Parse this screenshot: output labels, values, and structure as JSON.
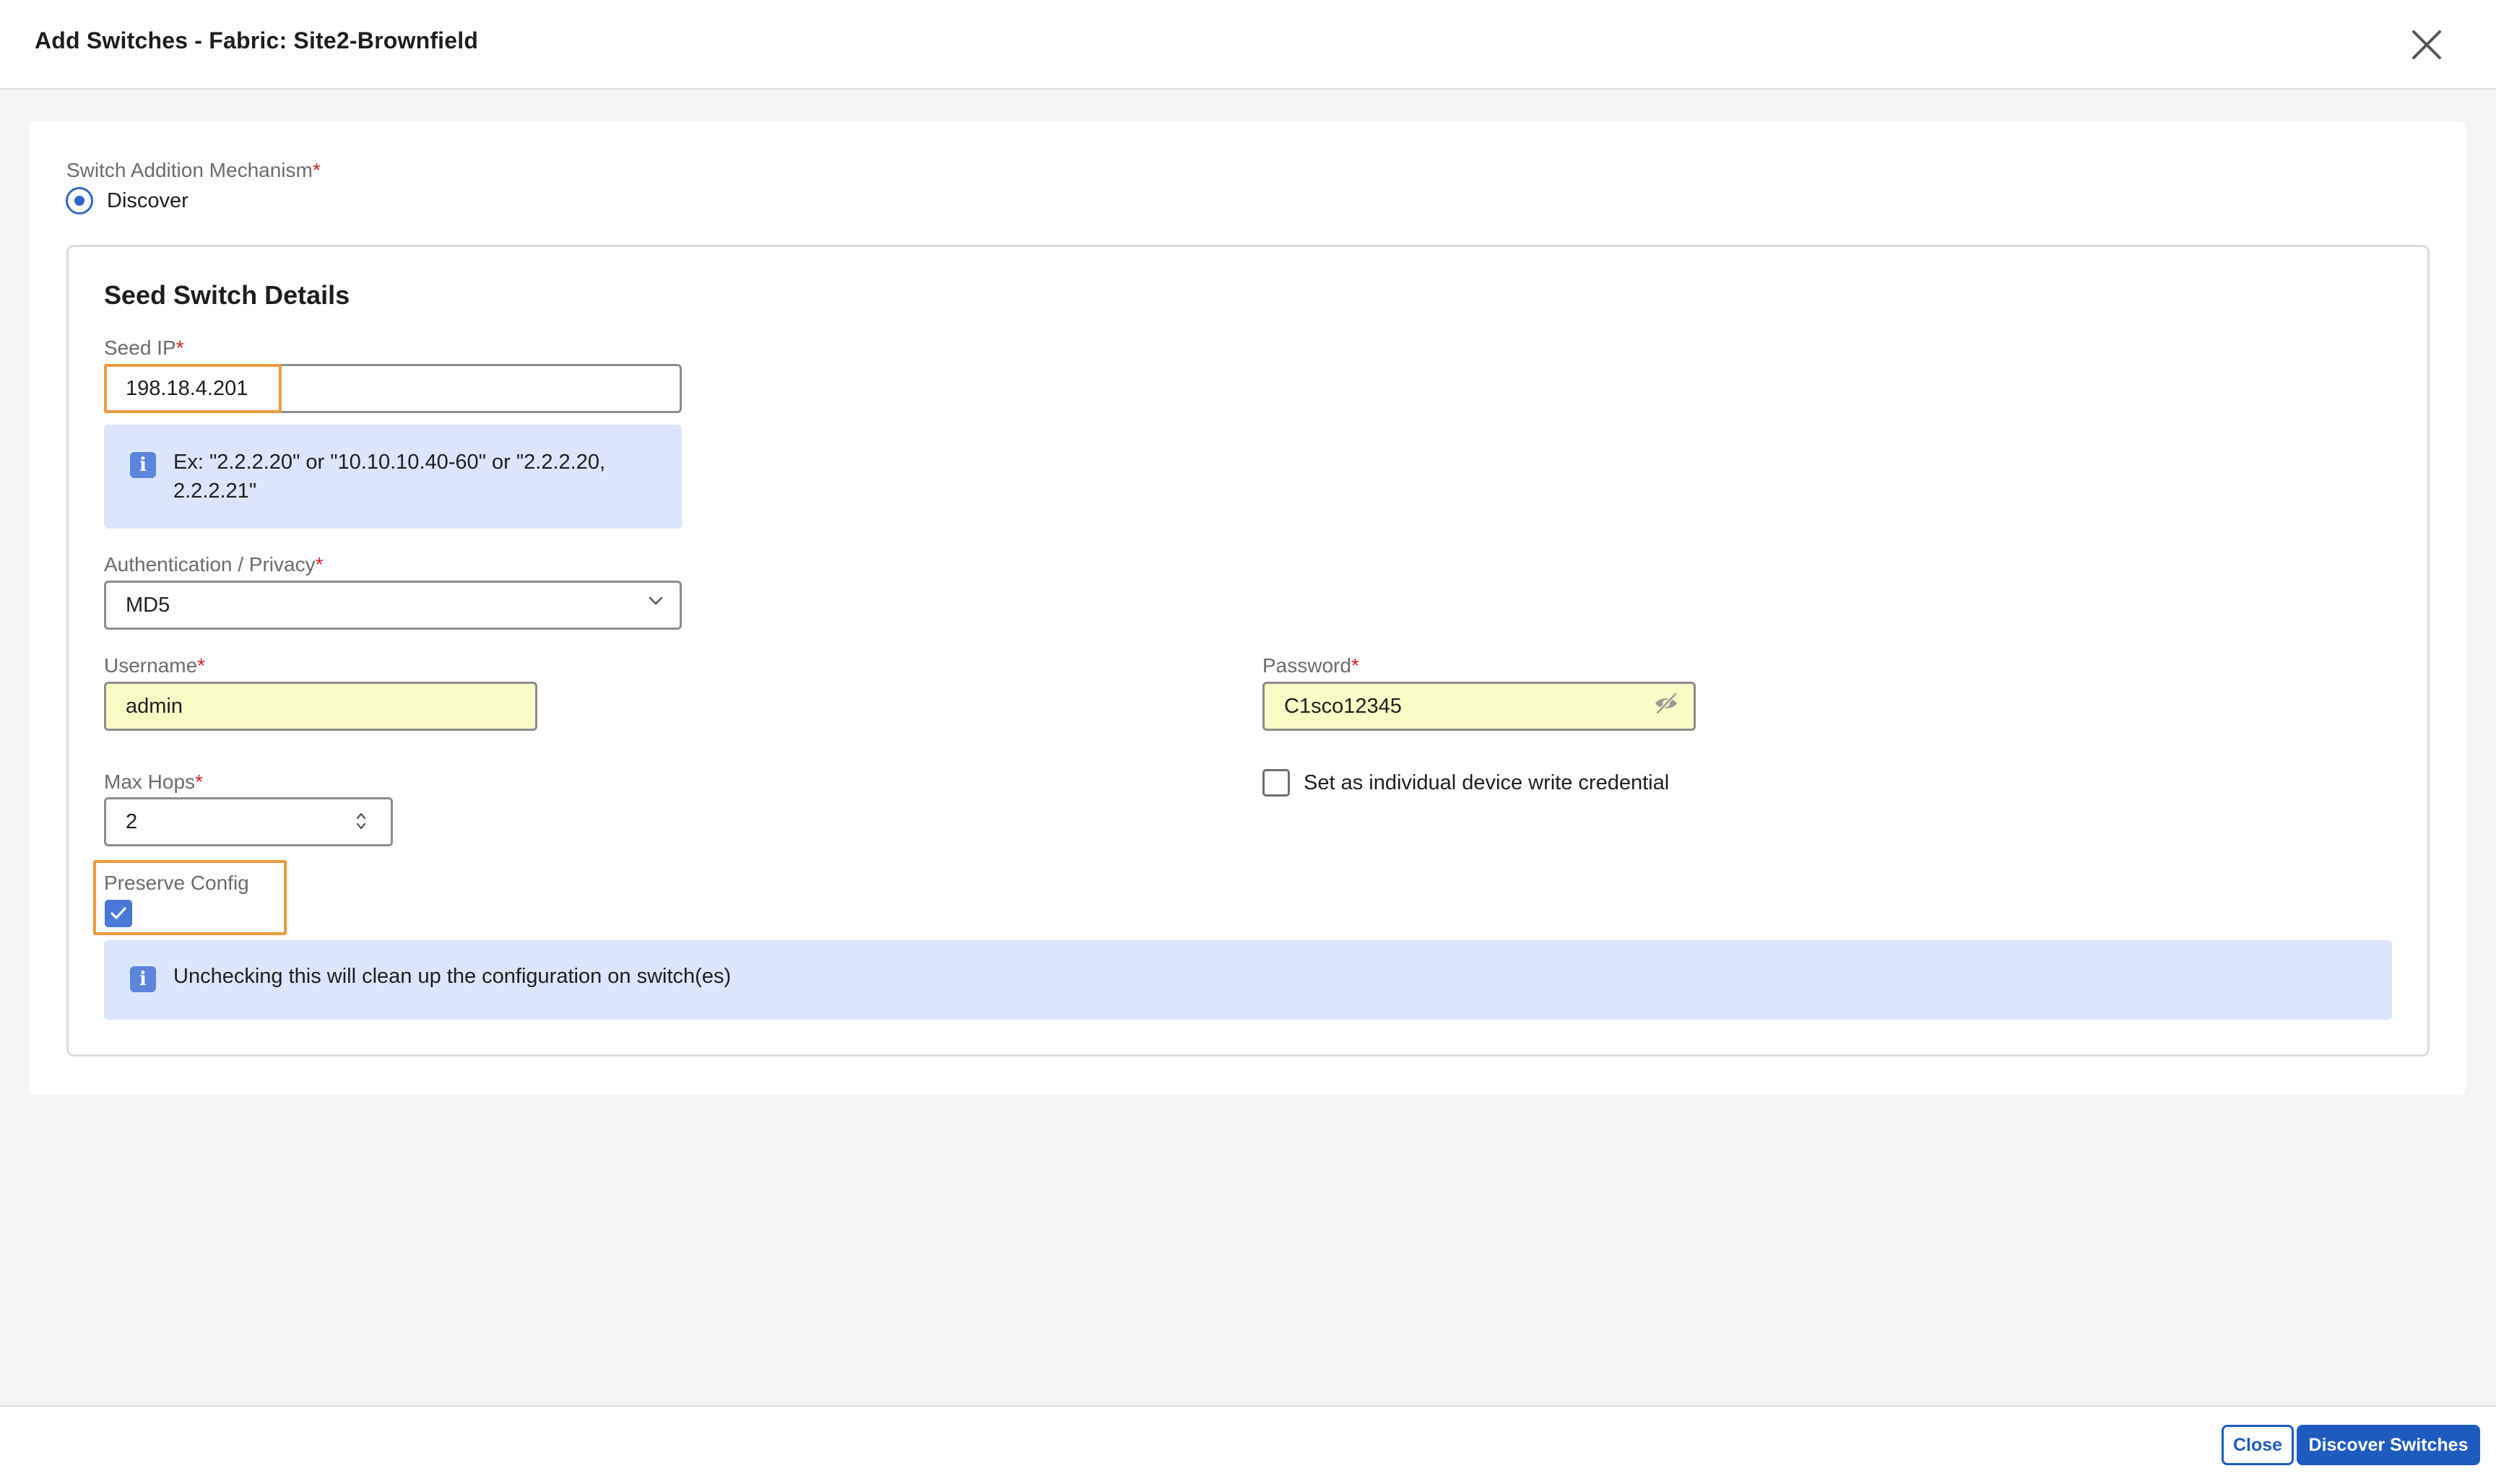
{
  "header": {
    "title": "Add Switches - Fabric: Site2-Brownfield",
    "close_icon": "close-icon"
  },
  "mechanism": {
    "label": "Switch Addition Mechanism",
    "required_mark": "*",
    "option_label": "Discover",
    "selected": true
  },
  "seed": {
    "section_title": "Seed Switch Details",
    "ip_label": "Seed IP",
    "ip_value": "198.18.4.201",
    "ip_hint_line1": "Ex: \"2.2.2.20\" or \"10.10.10.40-60\" or \"2.2.2.20,",
    "ip_hint_line2": "2.2.2.21\"",
    "auth_label": "Authentication / Privacy",
    "auth_value": "MD5",
    "username_label": "Username",
    "username_value": "admin",
    "password_label": "Password",
    "password_value": "C1sco12345",
    "max_hops_label": "Max Hops",
    "max_hops_value": "2",
    "write_cred_label": "Set as individual device write credential",
    "write_cred_checked": false,
    "preserve_label": "Preserve Config",
    "preserve_checked": true,
    "preserve_hint": "Unchecking this will clean up the configuration on switch(es)"
  },
  "footer": {
    "close_label": "Close",
    "discover_label": "Discover Switches"
  },
  "colors": {
    "primary": "#1e5bbf",
    "required": "#d32020",
    "highlight": "#ec9b3b",
    "info_bg": "#dbe5fb",
    "autofill_bg": "#fafcc6"
  }
}
